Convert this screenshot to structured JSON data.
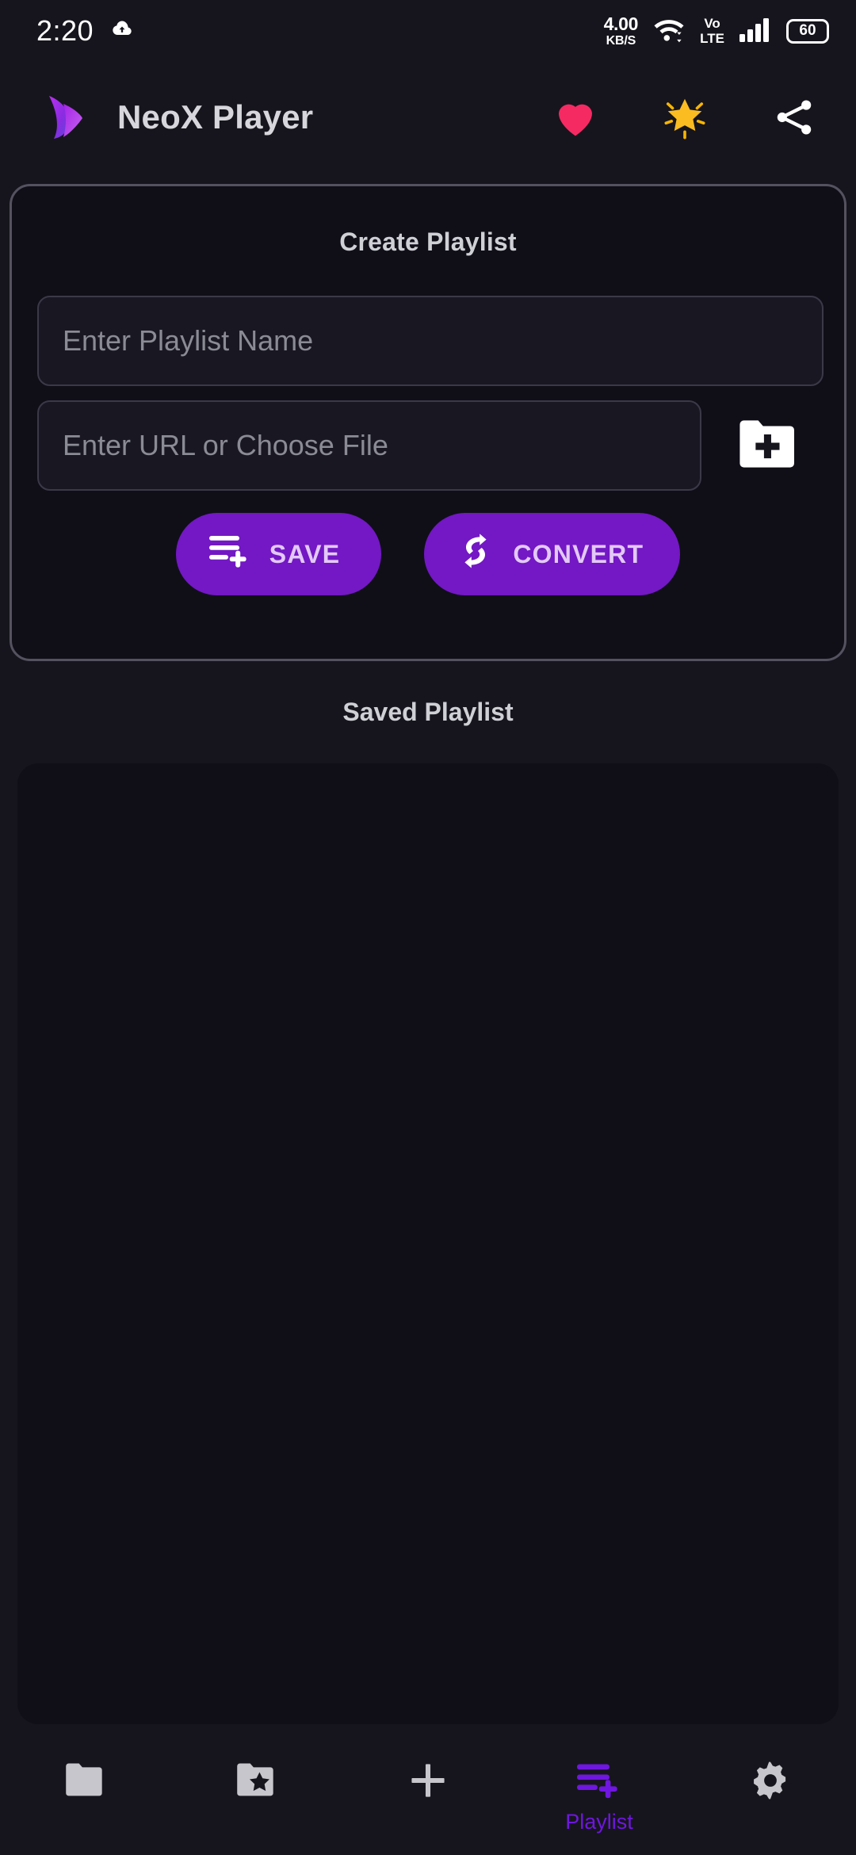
{
  "status_bar": {
    "time": "2:20",
    "download_icon": "cloud-download-icon",
    "net_speed_value": "4.00",
    "net_speed_unit": "KB/S",
    "wifi_icon": "wifi-icon",
    "volte_line1": "Vo",
    "volte_line2": "LTE",
    "signal_icon": "signal-bars-icon",
    "battery_level": "60"
  },
  "app_bar": {
    "logo_icon": "neox-play-logo",
    "title": "NeoX Player",
    "actions": [
      {
        "name": "favorite-icon",
        "label": "Favorite",
        "color": "#f52a63"
      },
      {
        "name": "star-icon",
        "label": "Rate",
        "color": "#ffc217"
      },
      {
        "name": "share-icon",
        "label": "Share",
        "color": "#ffffff"
      }
    ]
  },
  "create_playlist": {
    "title": "Create Playlist",
    "name_input": {
      "value": "",
      "placeholder": "Enter Playlist Name"
    },
    "url_input": {
      "value": "",
      "placeholder": "Enter URL or Choose File"
    },
    "choose_file_icon": "folder-add-icon",
    "save_label": "SAVE",
    "save_icon": "playlist-add-icon",
    "convert_label": "CONVERT",
    "convert_icon": "convert-sync-icon",
    "button_color": "#7318c4",
    "button_text_color": "#e3c9f7"
  },
  "saved_playlist": {
    "title": "Saved Playlist",
    "items": []
  },
  "bottom_nav": {
    "active_color": "#6f16e0",
    "inactive_color": "#c6c6cc",
    "items": [
      {
        "name": "nav-folder",
        "icon": "folder-icon",
        "label": "",
        "active": false
      },
      {
        "name": "nav-favorites",
        "icon": "folder-star-icon",
        "label": "",
        "active": false
      },
      {
        "name": "nav-add",
        "icon": "plus-icon",
        "label": "",
        "active": false
      },
      {
        "name": "nav-playlist",
        "icon": "playlist-add-icon",
        "label": "Playlist",
        "active": true
      },
      {
        "name": "nav-settings",
        "icon": "gear-icon",
        "label": "",
        "active": false
      }
    ]
  }
}
